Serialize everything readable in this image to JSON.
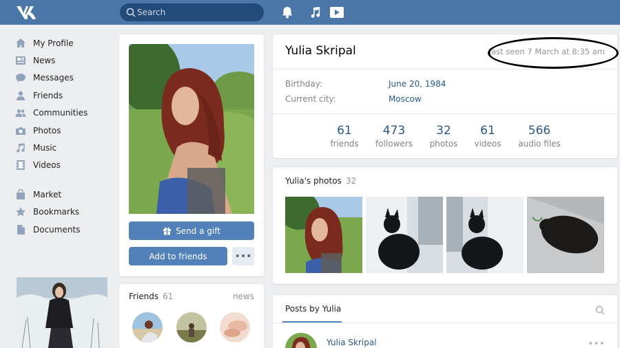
{
  "colors": {
    "topbar": "#4a76a8",
    "accent": "#5181b8",
    "link": "#2a5885",
    "muted": "#939393",
    "page_bg": "#edeef0"
  },
  "header": {
    "logo_icon": "vk-logo-icon",
    "search_placeholder": "Search",
    "icons": [
      "bell-icon",
      "music-note-icon",
      "video-play-icon"
    ]
  },
  "sidebar": {
    "items": [
      {
        "label": "My Profile",
        "icon": "home-icon"
      },
      {
        "label": "News",
        "icon": "news-icon"
      },
      {
        "label": "Messages",
        "icon": "chat-icon"
      },
      {
        "label": "Friends",
        "icon": "person-icon"
      },
      {
        "label": "Communities",
        "icon": "group-icon"
      },
      {
        "label": "Photos",
        "icon": "camera-icon"
      },
      {
        "label": "Music",
        "icon": "music-note-icon"
      },
      {
        "label": "Videos",
        "icon": "film-icon"
      }
    ],
    "secondary": [
      {
        "label": "Market",
        "icon": "bag-icon"
      },
      {
        "label": "Bookmarks",
        "icon": "star-icon"
      },
      {
        "label": "Documents",
        "icon": "document-icon"
      }
    ]
  },
  "profile_actions": {
    "send_gift": "Send a gift",
    "add_friend": "Add to friends",
    "more": "•••"
  },
  "friends": {
    "title": "Friends",
    "count": "61",
    "news_link": "news"
  },
  "profile": {
    "name": "Yulia Skripal",
    "last_seen": "last seen 7 March at 8:35 am",
    "birthday_label": "Birthday:",
    "birthday_value": "June 20, 1984",
    "city_label": "Current city:",
    "city_value": "Moscow",
    "counters": [
      {
        "num": "61",
        "label": "friends"
      },
      {
        "num": "473",
        "label": "followers"
      },
      {
        "num": "32",
        "label": "photos"
      },
      {
        "num": "61",
        "label": "videos"
      },
      {
        "num": "566",
        "label": "audio files"
      }
    ]
  },
  "photos": {
    "title": "Yulia's photos",
    "count": "32"
  },
  "posts": {
    "tab_label": "Posts by Yulia",
    "author": "Yulia Skripal",
    "more": "•••"
  }
}
